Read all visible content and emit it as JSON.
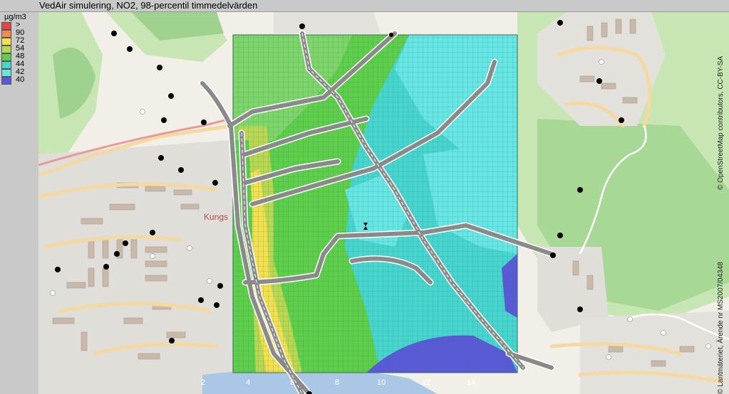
{
  "title": "VedAir simulering, NO2, 98-percentil timmedelvärden",
  "legend": {
    "unit": "µg/m3",
    "items": [
      {
        "label": ">",
        "color": "#e64545"
      },
      {
        "label": "90",
        "color": "#f08c54"
      },
      {
        "label": "72",
        "color": "#f2e04e"
      },
      {
        "label": "54",
        "color": "#b8d852"
      },
      {
        "label": "48",
        "color": "#5ecf4a"
      },
      {
        "label": "44",
        "color": "#46d6cf"
      },
      {
        "label": "42",
        "color": "#67e6e6"
      },
      {
        "label": "40",
        "color": "#5a5ad8"
      }
    ]
  },
  "map": {
    "place_label": "Kungs",
    "attribution_osm": "© OpenStreetMap contributors, CC-BY-SA",
    "attribution_lm": "© Lantmäteriet, Ärende nr MS2007/04348",
    "x_ticks": [
      "2",
      "4",
      "6",
      "8",
      "10",
      "12",
      "14"
    ]
  }
}
